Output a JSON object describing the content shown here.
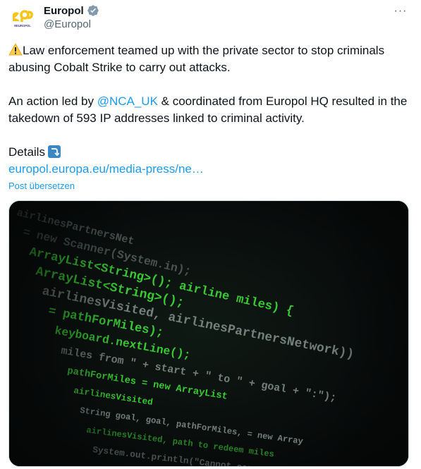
{
  "author": {
    "display_name": "Europol",
    "handle": "@Europol",
    "logo_text": "NEUROPOL",
    "avatar_icon": "europol-logo-icon",
    "verified_icon": "verified-badge-icon"
  },
  "menu": {
    "more_label": "···"
  },
  "tweet": {
    "line1": "Law enforcement teamed up with the private sector to stop criminals abusing Cobalt Strike to carry out attacks.",
    "p2_pre": "An action led by ",
    "mention": "@NCA_UK",
    "p2_post": " & coordinated from Europol HQ resulted in the takedown of 593 IP addresses linked to criminal activity.",
    "details_label": "Details",
    "link": "europol.europa.eu/media-press/ne…"
  },
  "translate": "Post übersetzen",
  "media": {
    "code_lines": [
      "airlinesPartnersNet",
      "= new Scanner(System.in);",
      "ArrayList<String>(); airline miles) {",
      "ArrayList<String>();",
      "airlinesVisited, airlinesPartnersNetwork))",
      "= pathForMiles);",
      "keyboard.nextLine();",
      "miles from \" + start + \" to \" + goal + \":\");",
      "pathForMiles = new ArrayList",
      "airlinesVisited",
      "String goal, goal, pathForMiles, = new Array",
      "airlinesVisited, path to redeem miles",
      "System.out.println(\"Cannot convert"
    ]
  },
  "colors": {
    "link": "#1d9bf0",
    "text": "#0f1419",
    "secondary": "#536471",
    "code_green": "#3fdc3a",
    "code_grey": "#7f8c8a",
    "logo_yellow": "#f6c51a"
  }
}
